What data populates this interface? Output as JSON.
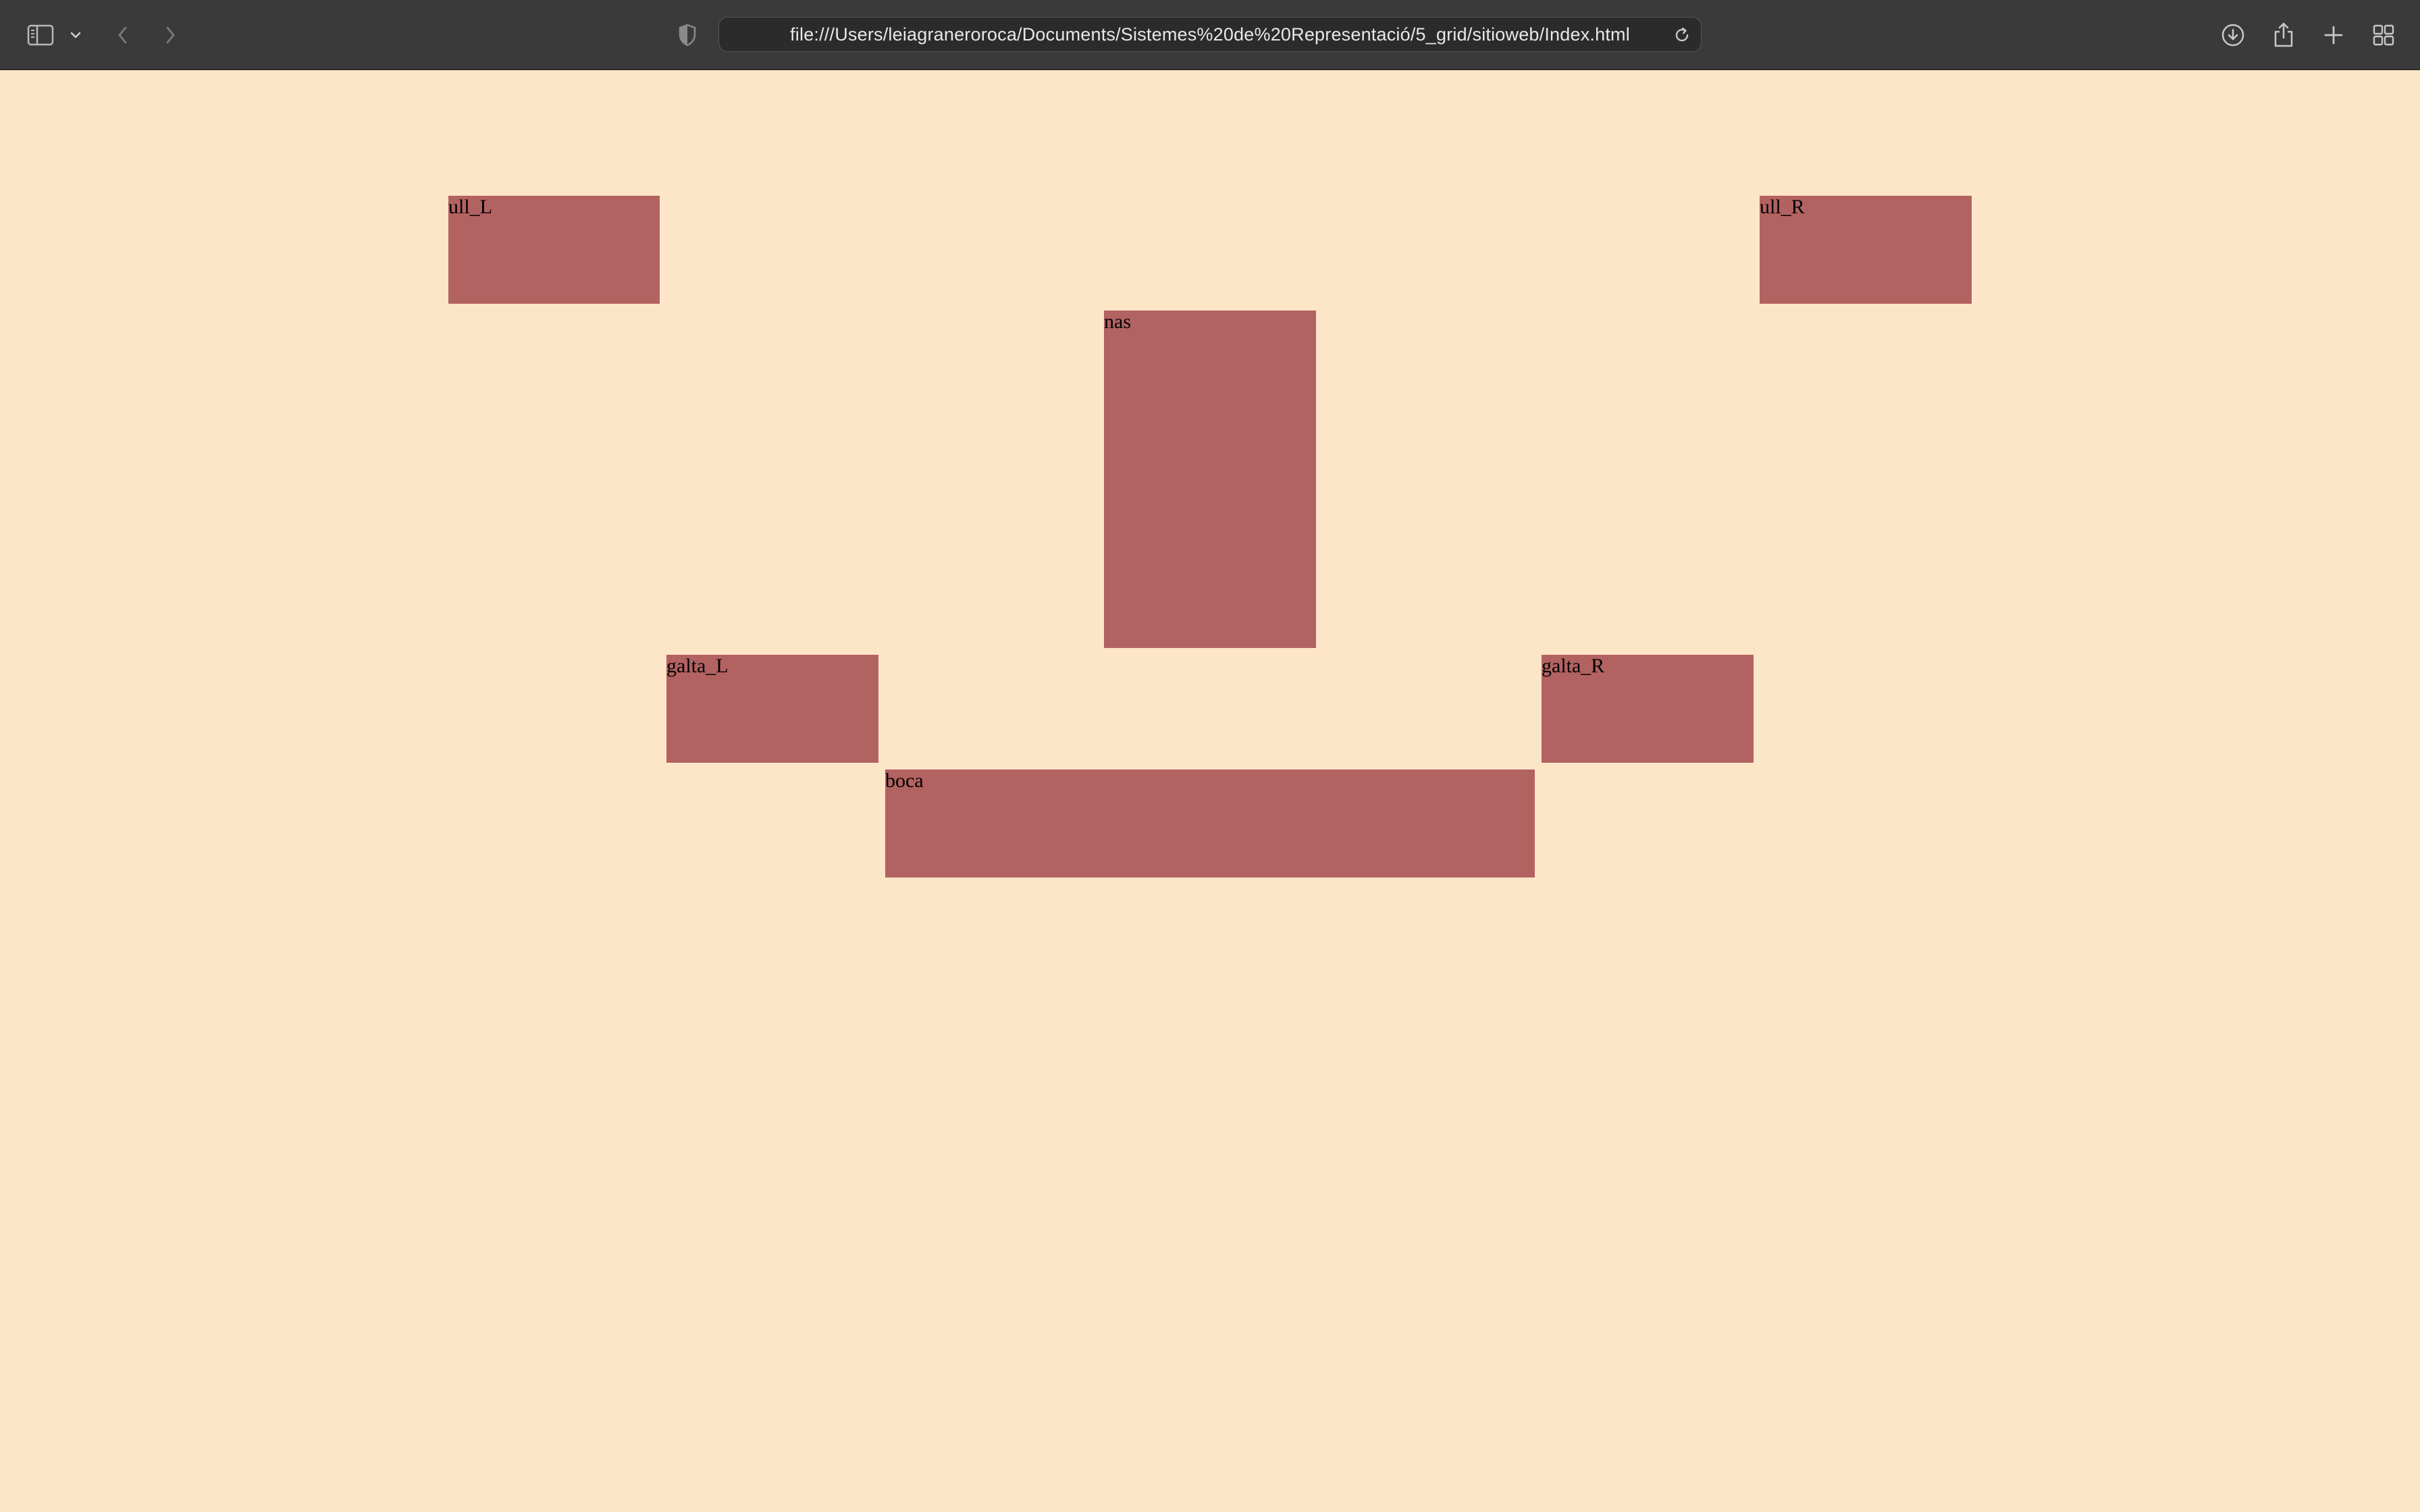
{
  "browser": {
    "url": "file:///Users/leiagraneroroca/Documents/Sistemes%20de%20Representació/5_grid/sitioweb/Index.html",
    "icons": {
      "sidebar": "sidebar-icon",
      "sidebar_menu": "chevron-down-icon",
      "back": "chevron-left-icon",
      "forward": "chevron-right-icon",
      "privacy": "shield-icon",
      "reload": "reload-icon",
      "downloads": "download-icon",
      "share": "share-icon",
      "new_tab": "plus-icon",
      "tab_overview": "tab-overview-icon"
    },
    "colors": {
      "toolbar": "#3a3a3a",
      "url_field": "#2b2b2b"
    }
  },
  "page": {
    "background": "#fde5c8",
    "box_color": "#b26261",
    "boxes": {
      "ull_l": "ull_L",
      "ull_r": "ull_R",
      "nas": "nas",
      "galta_l": "galta_L",
      "galta_r": "galta_R",
      "boca": "boca"
    }
  }
}
